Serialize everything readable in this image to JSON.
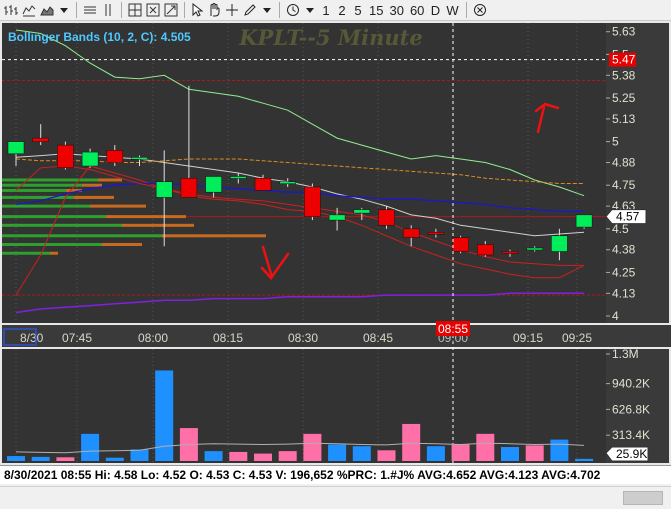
{
  "toolbar": {
    "icons": [
      "bar-chart-icon",
      "line-chart-icon",
      "area-chart-icon",
      "dropdown-arrow-icon",
      "horizontal-line-icon",
      "vertical-line-icon",
      "crosshair-icon",
      "zoom-fit-icon",
      "expand-icon",
      "pointer-icon",
      "hand-icon",
      "cross-icon",
      "pen-icon",
      "clock-icon",
      "close-circle-icon"
    ],
    "intervals": [
      "1",
      "2",
      "5",
      "15",
      "30",
      "60",
      "D",
      "W"
    ]
  },
  "chart_data": [
    {
      "type": "candlestick",
      "title": "KPLT--5 Minute",
      "indicator_label": "Bollinger Bands (10, 2, C): 4.505",
      "x_tick_labels": [
        "8/30",
        "07:45",
        "08:00",
        "08:15",
        "08:30",
        "08:45",
        "09:00",
        "09:15",
        "09:25"
      ],
      "crosshair_time": "08:55",
      "y_tick_labels": [
        "5.63",
        "5.5",
        "5.38",
        "5.25",
        "5.13",
        "5",
        "4.88",
        "4.75",
        "4.63",
        "4.5",
        "4.38",
        "4.25",
        "4.13",
        "4"
      ],
      "ylim": [
        3.96,
        5.68
      ],
      "crosshair_price": "5.47",
      "last_price": "4.57",
      "candles": [
        {
          "o": 4.93,
          "h": 4.98,
          "l": 4.86,
          "c": 5.0
        },
        {
          "o": 5.02,
          "h": 5.1,
          "l": 4.98,
          "c": 5.0
        },
        {
          "o": 4.98,
          "h": 5.0,
          "l": 4.84,
          "c": 4.85
        },
        {
          "o": 4.86,
          "h": 4.96,
          "l": 4.85,
          "c": 4.94
        },
        {
          "o": 4.95,
          "h": 4.98,
          "l": 4.86,
          "c": 4.88
        },
        {
          "o": 4.9,
          "h": 4.92,
          "l": 4.86,
          "c": 4.91
        },
        {
          "o": 4.68,
          "h": 4.95,
          "l": 4.4,
          "c": 4.77
        },
        {
          "o": 4.79,
          "h": 5.32,
          "l": 4.7,
          "c": 4.68
        },
        {
          "o": 4.71,
          "h": 4.8,
          "l": 4.68,
          "c": 4.8
        },
        {
          "o": 4.8,
          "h": 4.82,
          "l": 4.76,
          "c": 4.8
        },
        {
          "o": 4.79,
          "h": 4.81,
          "l": 4.72,
          "c": 4.72
        },
        {
          "o": 4.77,
          "h": 4.79,
          "l": 4.74,
          "c": 4.77
        },
        {
          "o": 4.74,
          "h": 4.76,
          "l": 4.55,
          "c": 4.57
        },
        {
          "o": 4.55,
          "h": 4.62,
          "l": 4.49,
          "c": 4.58
        },
        {
          "o": 4.59,
          "h": 4.62,
          "l": 4.55,
          "c": 4.61
        },
        {
          "o": 4.61,
          "h": 4.63,
          "l": 4.5,
          "c": 4.52
        },
        {
          "o": 4.5,
          "h": 4.52,
          "l": 4.4,
          "c": 4.45
        },
        {
          "o": 4.48,
          "h": 4.5,
          "l": 4.45,
          "c": 4.47
        },
        {
          "o": 4.45,
          "h": 4.46,
          "l": 4.36,
          "c": 4.37
        },
        {
          "o": 4.41,
          "h": 4.43,
          "l": 4.34,
          "c": 4.35
        },
        {
          "o": 4.37,
          "h": 4.38,
          "l": 4.34,
          "c": 4.36
        },
        {
          "o": 4.39,
          "h": 4.4,
          "l": 4.37,
          "c": 4.39
        },
        {
          "o": 4.37,
          "h": 4.5,
          "l": 4.32,
          "c": 4.46
        },
        {
          "o": 4.51,
          "h": 4.58,
          "l": 4.5,
          "c": 4.58
        }
      ],
      "bollinger_upper": [
        5.64,
        5.62,
        5.55,
        5.45,
        5.37,
        5.36,
        5.38,
        5.3,
        5.28,
        5.26,
        5.22,
        5.18,
        5.1,
        5.02,
        4.98,
        4.94,
        4.9,
        4.92,
        4.9,
        4.88,
        4.84,
        4.78,
        4.74,
        4.69
      ],
      "bollinger_mid": [
        4.91,
        4.92,
        4.93,
        4.92,
        4.91,
        4.9,
        4.88,
        4.86,
        4.84,
        4.82,
        4.79,
        4.77,
        4.74,
        4.7,
        4.67,
        4.63,
        4.58,
        4.56,
        4.52,
        4.5,
        4.48,
        4.46,
        4.47,
        4.48
      ],
      "bollinger_lower": [
        4.12,
        4.35,
        4.68,
        4.86,
        4.82,
        4.78,
        4.73,
        4.69,
        4.67,
        4.66,
        4.64,
        4.61,
        4.6,
        4.57,
        4.52,
        4.46,
        4.4,
        4.35,
        4.3,
        4.27,
        4.24,
        4.22,
        4.22,
        4.29
      ],
      "ma_orange": [
        4.9,
        4.89,
        4.89,
        4.89,
        4.88,
        4.88,
        4.89,
        4.9,
        4.9,
        4.9,
        4.89,
        4.88,
        4.87,
        4.86,
        4.85,
        4.84,
        4.83,
        4.82,
        4.81,
        4.79,
        4.78,
        4.77,
        4.76,
        4.76
      ],
      "ma_blue": [
        4.64,
        4.66,
        4.7,
        4.73,
        4.75,
        4.76,
        4.76,
        4.75,
        4.74,
        4.73,
        4.72,
        4.71,
        4.71,
        4.69,
        4.68,
        4.67,
        4.67,
        4.66,
        4.65,
        4.64,
        4.62,
        4.61,
        4.6,
        4.6
      ],
      "ma_purple": [
        4.02,
        4.04,
        4.05,
        4.06,
        4.07,
        4.08,
        4.09,
        4.09,
        4.1,
        4.1,
        4.1,
        4.11,
        4.11,
        4.11,
        4.11,
        4.12,
        4.12,
        4.12,
        4.12,
        4.12,
        4.13,
        4.13,
        4.13,
        4.13
      ],
      "ma_red": [
        4.72,
        4.85,
        4.86,
        4.84,
        4.8,
        4.76,
        4.73,
        4.7,
        4.68,
        4.67,
        4.66,
        4.64,
        4.62,
        4.6,
        4.58,
        4.54,
        4.48,
        4.43,
        4.38,
        4.34,
        4.31,
        4.3,
        4.29,
        4.29
      ],
      "horizontal_levels": [
        5.35,
        4.57,
        4.12
      ],
      "volume_profile": [
        {
          "price": 4.78,
          "green": 0.24,
          "red": 0.06
        },
        {
          "price": 4.75,
          "green": 0.2,
          "red": 0.05
        },
        {
          "price": 4.72,
          "green": 0.16,
          "red": 0.04
        },
        {
          "price": 4.68,
          "green": 0.18,
          "red": 0.1
        },
        {
          "price": 4.63,
          "green": 0.22,
          "red": 0.14
        },
        {
          "price": 4.57,
          "green": 0.26,
          "red": 0.2
        },
        {
          "price": 4.52,
          "green": 0.3,
          "red": 0.18
        },
        {
          "price": 4.46,
          "green": 0.4,
          "red": 0.26
        },
        {
          "price": 4.41,
          "green": 0.25,
          "red": 0.1
        },
        {
          "price": 4.36,
          "green": 0.12,
          "red": 0.02
        }
      ],
      "colors": {
        "up": "#00ee5a",
        "down": "#ee0000",
        "background": "#333333",
        "upper_band": "#90ee90",
        "mid_band": "#d0d0d0",
        "lower_band": "#cc2020",
        "orange": "#e08a20",
        "blue": "#1818d0",
        "purple": "#8020e0"
      }
    },
    {
      "type": "bar",
      "title": "Volume",
      "y_tick_labels": [
        "1.3M",
        "940.2K",
        "626.8K",
        "313.4K"
      ],
      "ylim": [
        0,
        1300000
      ],
      "last_value": "25.9K",
      "values": [
        60000,
        50000,
        45000,
        330000,
        40000,
        140000,
        1100000,
        400000,
        120000,
        110000,
        90000,
        120000,
        330000,
        200000,
        180000,
        130000,
        450000,
        180000,
        200000,
        330000,
        170000,
        190000,
        260000,
        25900
      ],
      "volume_ma": [
        110000,
        105000,
        100000,
        120000,
        125000,
        130000,
        180000,
        200000,
        210000,
        205000,
        200000,
        205000,
        215000,
        210000,
        200000,
        195000,
        215000,
        210000,
        200000,
        215000,
        210000,
        200000,
        205000,
        190000
      ],
      "colors": [
        "#1e90ff",
        "#1e90ff",
        "#ff6fa8",
        "#1e90ff",
        "#1e90ff",
        "#1e90ff",
        "#1e90ff",
        "#ff6fa8",
        "#1e90ff",
        "#ff6fa8",
        "#ff6fa8",
        "#ff6fa8",
        "#ff6fa8",
        "#1e90ff",
        "#1e90ff",
        "#ff6fa8",
        "#ff6fa8",
        "#1e90ff",
        "#ff6fa8",
        "#ff6fa8",
        "#1e90ff",
        "#ff6fa8",
        "#1e90ff",
        "#1e90ff"
      ]
    }
  ],
  "status_bar": {
    "text": "8/30/2021 08:55  Hi: 4.58  Lo: 4.52  O: 4.53  C: 4.53  V: 196,652 %PRC: 1.#J% AVG:4.652 AVG:4.123 AVG:4.702"
  }
}
